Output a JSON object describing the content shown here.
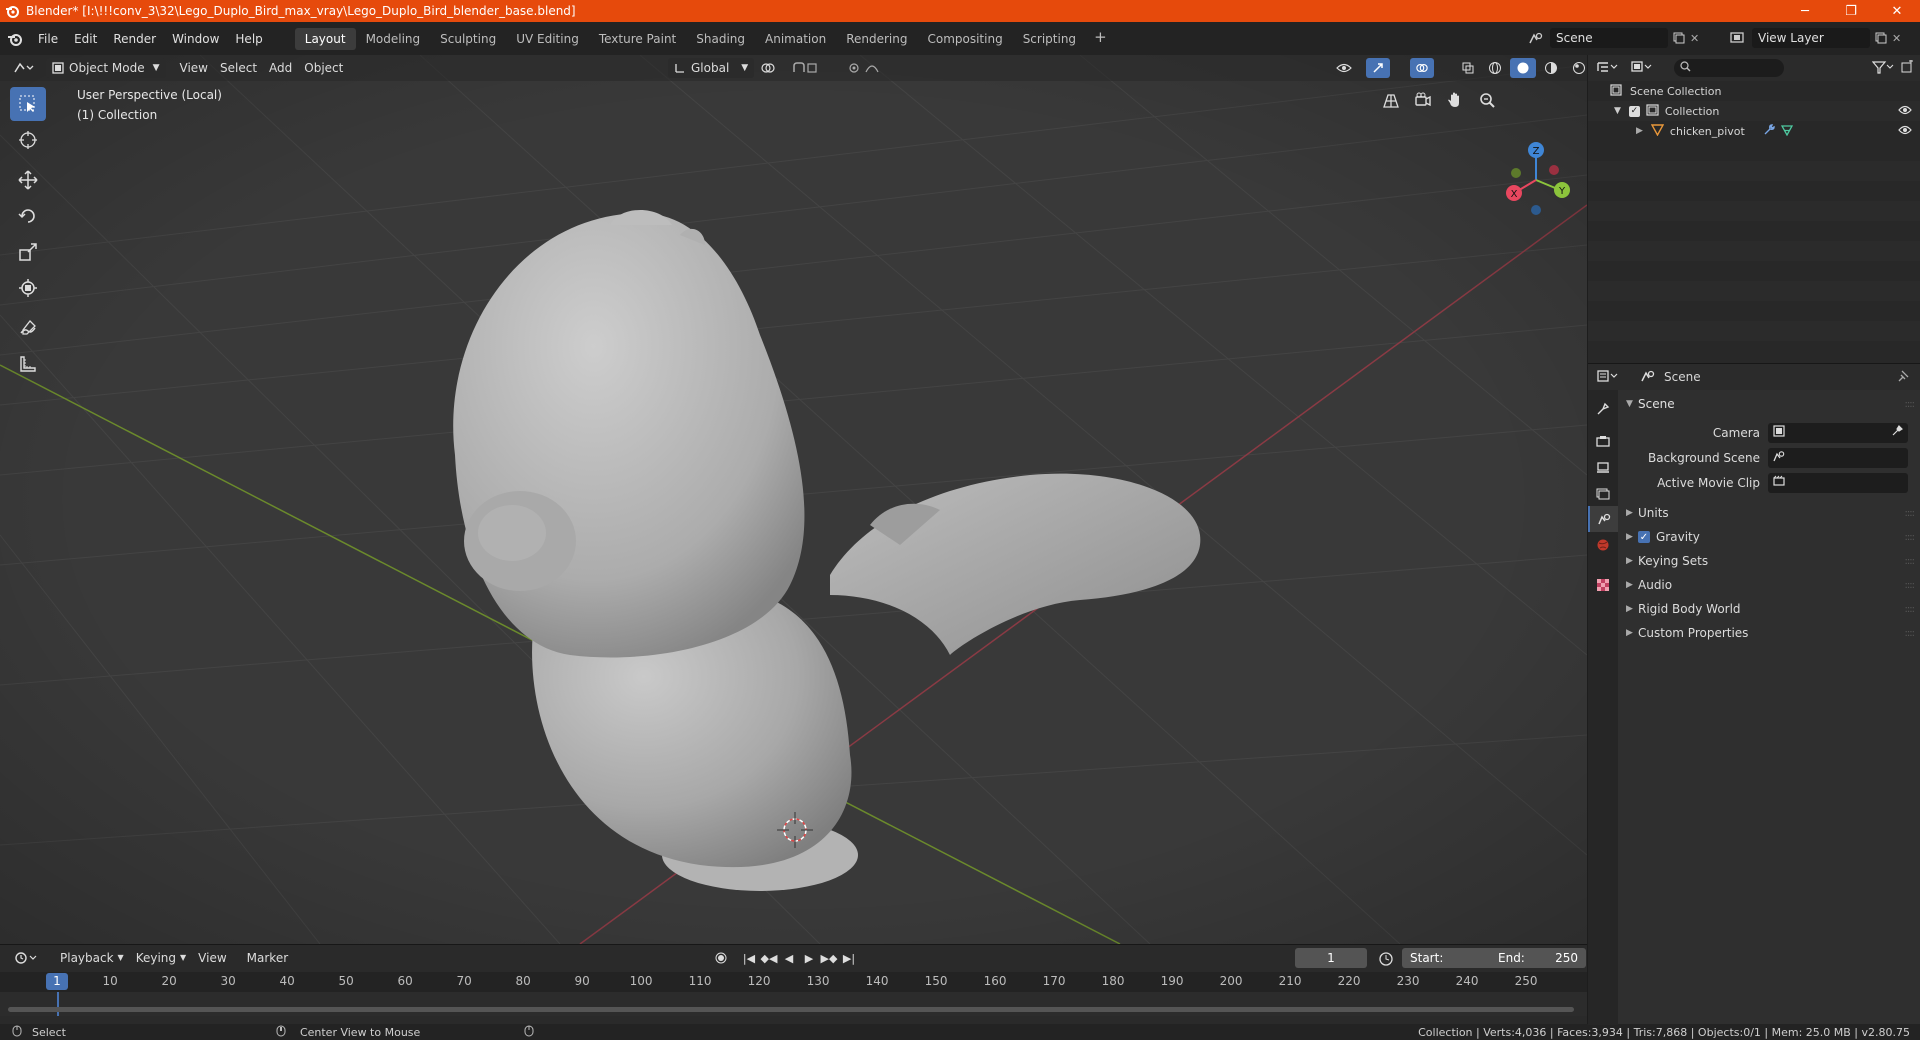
{
  "window": {
    "title": "Blender* [I:\\!!!conv_3\\32\\Lego_Duplo_Bird_max_vray\\Lego_Duplo_Bird_blender_base.blend]",
    "minimize": "─",
    "restore": "❐",
    "close": "✕"
  },
  "menu": [
    "File",
    "Edit",
    "Render",
    "Window",
    "Help"
  ],
  "workspaces": [
    "Layout",
    "Modeling",
    "Sculpting",
    "UV Editing",
    "Texture Paint",
    "Shading",
    "Animation",
    "Rendering",
    "Compositing",
    "Scripting"
  ],
  "workspace_add": "+",
  "scene_name": "Scene",
  "view_layer": "View Layer",
  "viewport": {
    "mode": "Object Mode",
    "menus": [
      "View",
      "Select",
      "Add",
      "Object"
    ],
    "orientation": "Global",
    "info_line1": "User Perspective (Local)",
    "info_line2": "(1) Collection"
  },
  "gizmo": {
    "x": "X",
    "y": "Y",
    "z": "Z"
  },
  "timeline": {
    "menus": [
      "Playback",
      "Keying",
      "View",
      "Marker"
    ],
    "current_frame": "1",
    "start_label": "Start:",
    "start": "1",
    "end_label": "End:",
    "end": "250",
    "ruler": [
      "1",
      "10",
      "20",
      "30",
      "40",
      "50",
      "60",
      "70",
      "80",
      "90",
      "100",
      "110",
      "120",
      "130",
      "140",
      "150",
      "160",
      "170",
      "180",
      "190",
      "200",
      "210",
      "220",
      "230",
      "240",
      "250"
    ]
  },
  "statusbar": {
    "select": "Select",
    "center": "Center View to Mouse",
    "stats": "Collection | Verts:4,036 | Faces:3,934 | Tris:7,868 | Objects:0/1 | Mem: 25.0 MB | v2.80.75"
  },
  "outliner": {
    "root": "Scene Collection",
    "collection": "Collection",
    "object": "chicken_pivot"
  },
  "properties": {
    "context": "Scene",
    "panel": "Scene",
    "camera_label": "Camera",
    "background_label": "Background Scene",
    "movieclip_label": "Active Movie Clip",
    "subpanels": [
      "Units",
      "Gravity",
      "Keying Sets",
      "Audio",
      "Rigid Body World",
      "Custom Properties"
    ]
  },
  "colors": {
    "accent": "#4772b3",
    "titlebar": "#e64a0c",
    "x_axis": "#e8475f",
    "y_axis": "#8cc43c",
    "z_axis": "#3f86d6"
  }
}
